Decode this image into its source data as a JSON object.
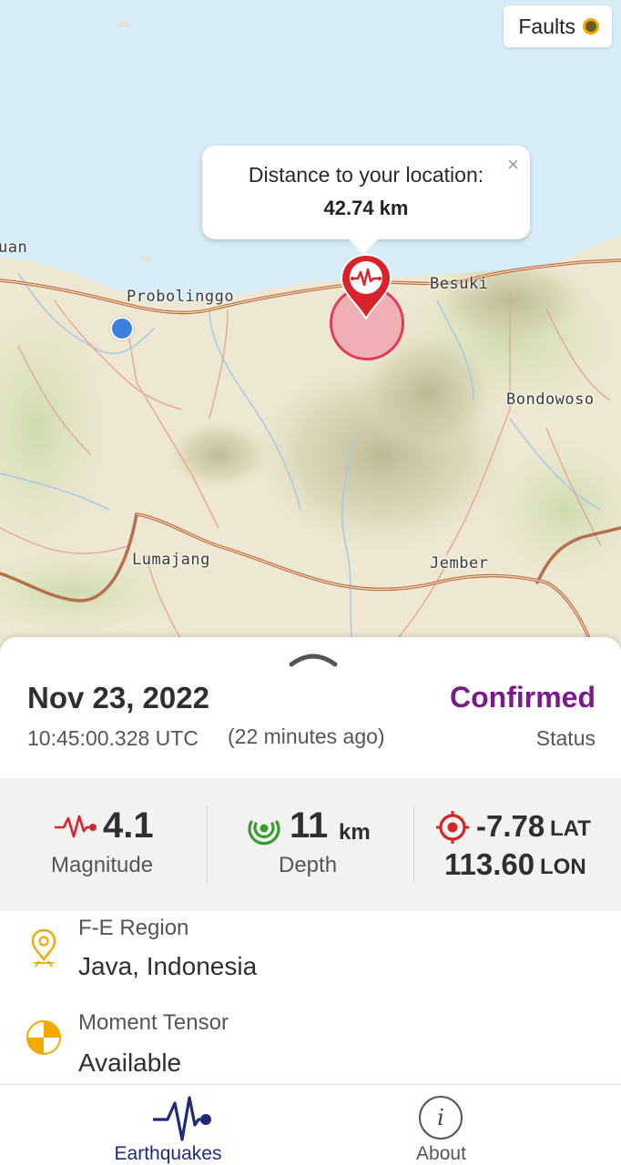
{
  "map": {
    "faults_toggle_label": "Faults",
    "popup": {
      "title": "Distance to your location:",
      "distance": "42.74 km",
      "close_symbol": "×"
    },
    "place_labels": {
      "probolinggo": "Probolinggo",
      "besuki": "Besuki",
      "bondowoso": "Bondowoso",
      "lumajang": "Lumajang",
      "jember": "Jember",
      "edge": "uan"
    }
  },
  "event": {
    "date": "Nov 23, 2022",
    "time_utc": "10:45:00.328 UTC",
    "relative_time": "(22 minutes ago)",
    "status_value": "Confirmed",
    "status_label": "Status",
    "magnitude_value": "4.1",
    "magnitude_label": "Magnitude",
    "depth_value": "11",
    "depth_unit": "km",
    "depth_label": "Depth",
    "lat_value": "-7.78",
    "lat_unit": "LAT",
    "lon_value": "113.60",
    "lon_unit": "LON",
    "region_label": "F-E Region",
    "region_value": "Java, Indonesia",
    "tensor_label": "Moment Tensor",
    "tensor_value": "Available"
  },
  "nav": {
    "earthquakes_label": "Earthquakes",
    "about_label": "About",
    "about_icon_glyph": "i"
  },
  "colors": {
    "status_confirmed": "#7a1a8c",
    "magnitude_icon": "#d8232a",
    "depth_icon": "#3a9b2e",
    "location_icon": "#d8232a",
    "active_nav": "#1f2a78",
    "sea": "#d6ecf6",
    "land": "#efe9d4"
  }
}
